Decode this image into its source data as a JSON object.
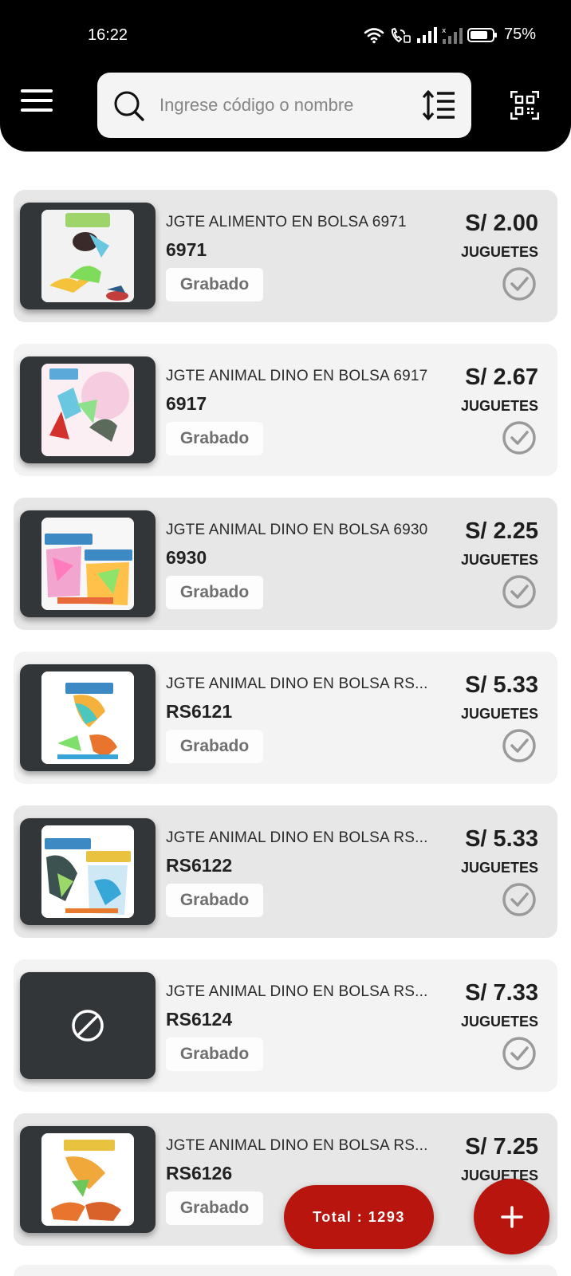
{
  "status_bar": {
    "time": "16:22",
    "battery": "75%",
    "icons": [
      "wifi-icon",
      "vowifi-call-icon",
      "signal-icon",
      "no-signal-icon",
      "battery-icon"
    ]
  },
  "header": {
    "menu_icon": "hamburger-menu-icon",
    "search": {
      "placeholder": "Ingrese código o nombre",
      "value": ""
    },
    "sort_icon": "sort-vertical-icon",
    "scan_icon": "qr-scan-icon"
  },
  "products": [
    {
      "name": "JGTE ALIMENTO EN BOLSA 6971",
      "code": "6971",
      "status": "Grabado",
      "price": "S/ 2.00",
      "category": "JUGUETES",
      "has_image": true
    },
    {
      "name": "JGTE ANIMAL DINO EN BOLSA 6917",
      "code": "6917",
      "status": "Grabado",
      "price": "S/ 2.67",
      "category": "JUGUETES",
      "has_image": true
    },
    {
      "name": "JGTE ANIMAL DINO EN BOLSA 6930",
      "code": "6930",
      "status": "Grabado",
      "price": "S/ 2.25",
      "category": "JUGUETES",
      "has_image": true
    },
    {
      "name": "JGTE ANIMAL DINO EN BOLSA RS...",
      "code": "RS6121",
      "status": "Grabado",
      "price": "S/ 5.33",
      "category": "JUGUETES",
      "has_image": true
    },
    {
      "name": "JGTE ANIMAL DINO EN BOLSA RS...",
      "code": "RS6122",
      "status": "Grabado",
      "price": "S/ 5.33",
      "category": "JUGUETES",
      "has_image": true
    },
    {
      "name": "JGTE ANIMAL DINO EN BOLSA RS...",
      "code": "RS6124",
      "status": "Grabado",
      "price": "S/ 7.33",
      "category": "JUGUETES",
      "has_image": false
    },
    {
      "name": "JGTE ANIMAL DINO EN BOLSA RS...",
      "code": "RS6126",
      "status": "Grabado",
      "price": "S/ 7.25",
      "category": "JUGUETES",
      "has_image": true
    }
  ],
  "footer": {
    "total_label": "Total : 1293",
    "add_icon": "plus-icon"
  },
  "colors": {
    "accent": "#b7150d",
    "header_bg": "#000000",
    "card_alt": "#e7e7e7",
    "card_plain": "#f3f3f3",
    "thumb_frame": "#333639"
  }
}
